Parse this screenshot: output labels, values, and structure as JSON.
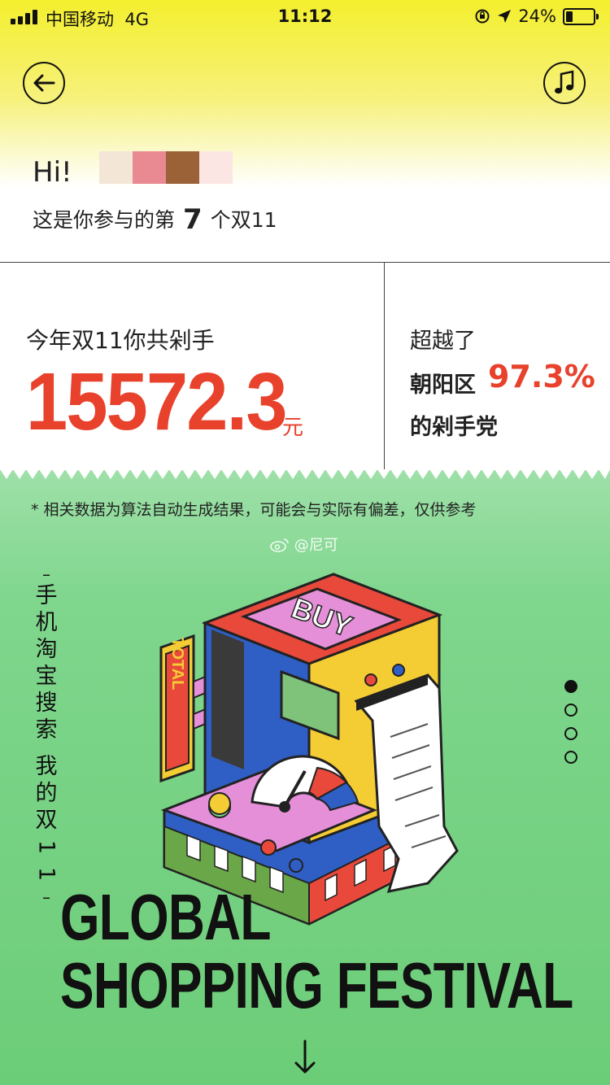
{
  "status_bar": {
    "carrier": "中国移动",
    "network": "4G",
    "time": "11:12",
    "battery": "24%"
  },
  "header": {
    "back_icon": "arrow-left-icon",
    "music_icon": "music-note-icon",
    "greeting": "Hi!",
    "name_block_colors": [
      "#f3e6d6",
      "#e98a92",
      "#9b6238",
      "#fbe6e3"
    ],
    "participation_prefix": "这是你参与的第",
    "participation_count": "7",
    "participation_suffix": "个双11"
  },
  "stats": {
    "spent_label": "今年双11你共剁手",
    "amount": "15572.3",
    "currency": "元",
    "beyond_label": "超越了",
    "district": "朝阳区",
    "percent": "97.3%",
    "party_label": "的剁手党",
    "accent_color": "#e8412c"
  },
  "poster": {
    "disclaimer": "* 相关数据为算法自动生成结果，可能会与实际有偏差，仅供参考",
    "watermark": "@尼可",
    "vertical_text": "手机淘宝搜索 我的双11",
    "illustration_buy": "BUY",
    "illustration_total": "TOTAL",
    "headline_line1": "GLOBAL",
    "headline_line2": "SHOPPING FESTIVAL",
    "page_dots": 4,
    "active_dot": 1,
    "scroll_icon": "arrow-down-icon"
  }
}
